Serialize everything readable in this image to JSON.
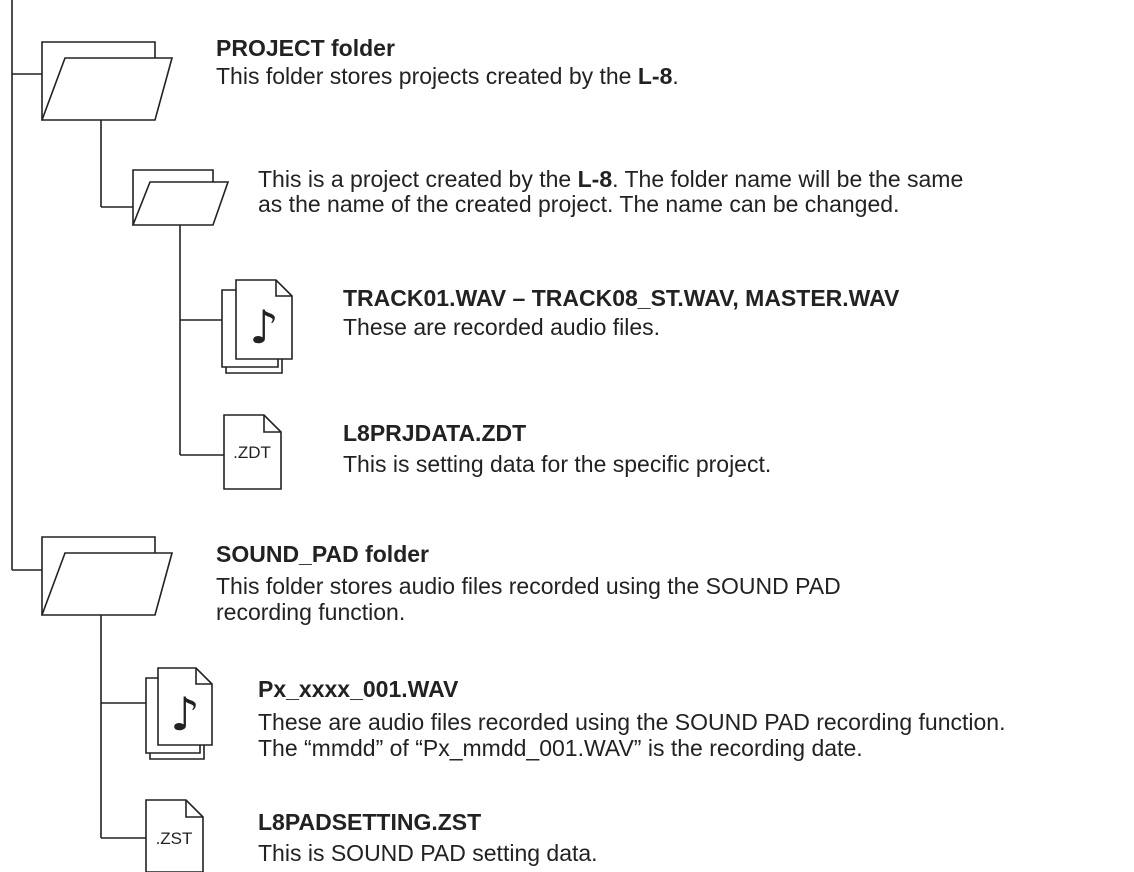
{
  "project_folder": {
    "title": "PROJECT folder",
    "desc_pre": "This folder stores projects created by the ",
    "desc_strong": "L-8",
    "desc_post": "."
  },
  "project": {
    "line1_pre": "This is a project created by the ",
    "line1_strong": "L-8",
    "line1_post": ". The folder name will be the same",
    "line2": "as the name of the created project. The name can be changed."
  },
  "track_files": {
    "title": "TRACK01.WAV – TRACK08_ST.WAV, MASTER.WAV",
    "desc": "These are recorded audio files."
  },
  "prj_data": {
    "icon_label": ".ZDT",
    "title": "L8PRJDATA.ZDT",
    "desc": "This is setting data for the specific project."
  },
  "sound_pad_folder": {
    "title": "SOUND_PAD folder",
    "desc_line1": "This folder stores audio files recorded using the SOUND PAD",
    "desc_line2": "recording function."
  },
  "pad_files": {
    "title": "Px_xxxx_001.WAV",
    "desc_line1": "These are audio files recorded using the SOUND PAD recording function.",
    "desc_line2": "The “mmdd” of “Px_mmdd_001.WAV” is the recording date."
  },
  "pad_setting": {
    "icon_label": ".ZST",
    "title": "L8PADSETTING.ZST",
    "desc": "This is SOUND PAD setting data."
  },
  "icons": {
    "folder": "folder-icon",
    "audio": "audio-file-stack-icon",
    "data": "data-file-icon",
    "note_glyph": "♪"
  }
}
